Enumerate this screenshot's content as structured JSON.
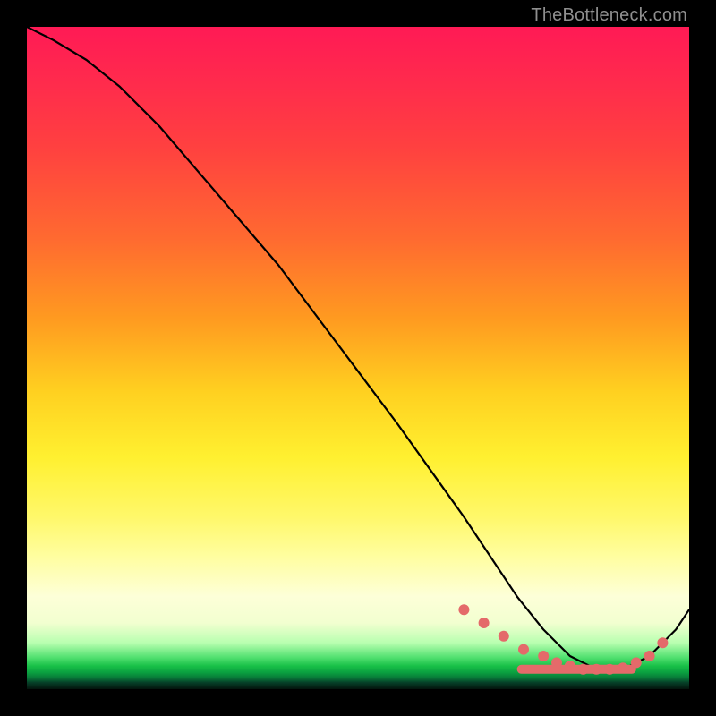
{
  "watermark": "TheBottleneck.com",
  "colors": {
    "dot": "#e46a6a",
    "line": "#000000"
  },
  "chart_data": {
    "type": "line",
    "title": "",
    "xlabel": "",
    "ylabel": "",
    "xlim": [
      0,
      100
    ],
    "ylim": [
      0,
      100
    ],
    "grid": false,
    "legend": false,
    "series": [
      {
        "name": "curve",
        "x": [
          0,
          4,
          9,
          14,
          20,
          26,
          32,
          38,
          44,
          50,
          56,
          61,
          66,
          70,
          74,
          78,
          82,
          86,
          90,
          94,
          98,
          100
        ],
        "y": [
          100,
          98,
          95,
          91,
          85,
          78,
          71,
          64,
          56,
          48,
          40,
          33,
          26,
          20,
          14,
          9,
          5,
          3,
          3,
          5,
          9,
          12
        ]
      }
    ],
    "markers": {
      "name": "dots",
      "x": [
        66,
        69,
        72,
        75,
        78,
        80,
        82,
        84,
        86,
        88,
        90,
        92,
        94,
        96
      ],
      "y": [
        12,
        10,
        8,
        6,
        5,
        4,
        3.5,
        3,
        3,
        3,
        3.2,
        4,
        5,
        7
      ]
    },
    "trough_segment": {
      "x_start": 74,
      "x_end": 92,
      "y": 3
    }
  }
}
